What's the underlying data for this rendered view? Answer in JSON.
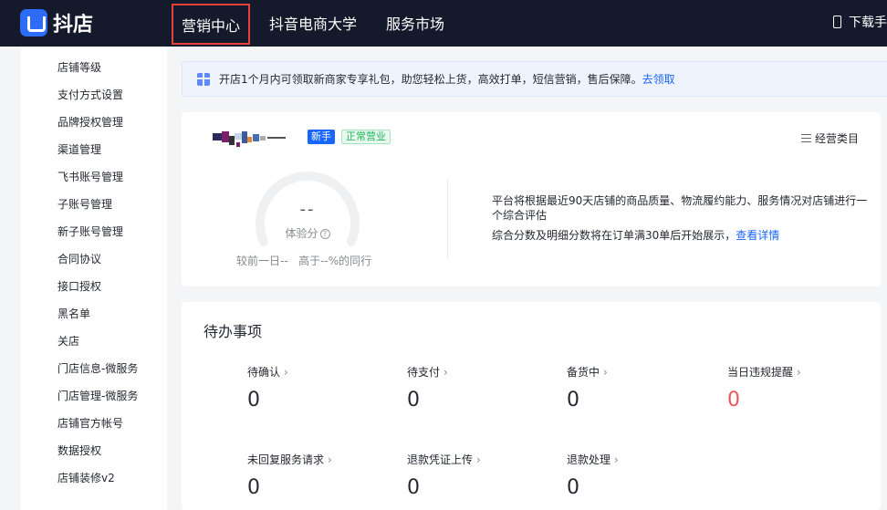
{
  "header": {
    "logo_text": "抖店",
    "nav": [
      "营销中心",
      "抖音电商大学",
      "服务市场"
    ],
    "download_label": "下载手"
  },
  "sidebar": {
    "items": [
      "店铺等级",
      "支付方式设置",
      "品牌授权管理",
      "渠道管理",
      "飞书账号管理",
      "子账号管理",
      "新子账号管理",
      "合同协议",
      "接口授权",
      "黑名单",
      "关店",
      "门店信息-微服务",
      "门店管理-微服务",
      "店铺官方帐号",
      "数据授权",
      "店铺装修v2"
    ]
  },
  "banner": {
    "text": "开店1个月内可领取新商家专享礼包，助您轻松上货，高效打单，短信营销，售后保障。",
    "link": "去领取"
  },
  "shop": {
    "tag_new": "新手",
    "tag_status": "正常营业",
    "category_link": "经营类目",
    "score_value": "--",
    "score_label": "体验分",
    "compare_text": "较前一日--   高于--%的同行",
    "desc_line1": "平台将根据最近90天店铺的商品质量、物流履约能力、服务情况对店铺进行一个综合评估",
    "desc_line2": "综合分数及明细分数将在订单满30单后开始展示，",
    "detail_link": "查看详情"
  },
  "todo": {
    "title": "待办事项",
    "items": [
      {
        "label": "待确认",
        "value": "0"
      },
      {
        "label": "待支付",
        "value": "0"
      },
      {
        "label": "备货中",
        "value": "0"
      },
      {
        "label": "当日违规提醒",
        "value": "0"
      },
      {
        "label": "未回复服务请求",
        "value": "0"
      },
      {
        "label": "退款凭证上传",
        "value": "0"
      },
      {
        "label": "退款处理",
        "value": "0"
      }
    ]
  },
  "colors": {
    "topbar": "#141a2b",
    "accent": "#1966ff",
    "highlight_border": "#e8413a",
    "alert": "#f0555a",
    "status_green": "#20b25a"
  }
}
